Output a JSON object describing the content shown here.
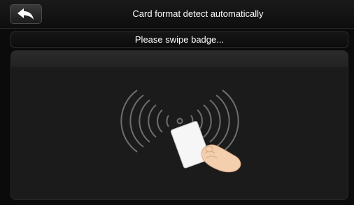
{
  "header": {
    "title": "Card format detect automatically",
    "back_icon": "back-arrow-icon"
  },
  "prompt": {
    "text": "Please swipe badge..."
  },
  "illustration": {
    "icon": "card-swipe-illustration"
  },
  "colors": {
    "background": "#0b0b0b",
    "panel": "#1b1b1b",
    "text": "#ffffff",
    "wave": "#6e6e6e",
    "card": "#f4f4f4",
    "hand": "#f3cfae"
  }
}
